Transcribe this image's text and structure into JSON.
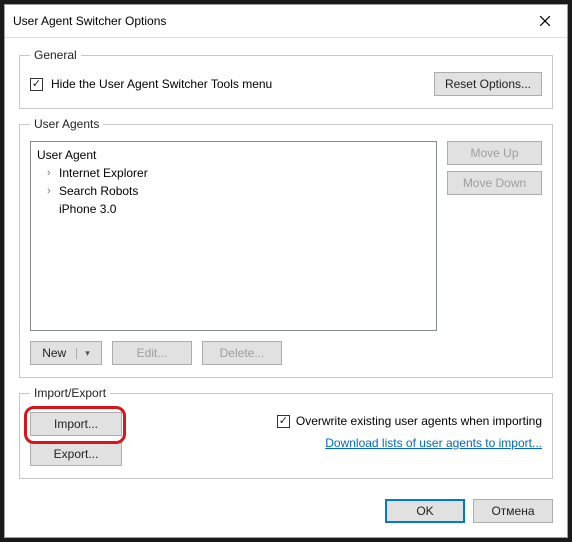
{
  "window": {
    "title": "User Agent Switcher Options"
  },
  "general": {
    "legend": "General",
    "hide_menu_label": "Hide the User Agent Switcher Tools menu",
    "hide_menu_checked": true,
    "reset_label": "Reset Options..."
  },
  "user_agents": {
    "legend": "User Agents",
    "items": [
      {
        "label": "User Agent",
        "expandable": false,
        "indent": 0
      },
      {
        "label": "Internet Explorer",
        "expandable": true,
        "indent": 1
      },
      {
        "label": "Search Robots",
        "expandable": true,
        "indent": 1
      },
      {
        "label": "iPhone 3.0",
        "expandable": false,
        "indent": 2
      }
    ],
    "move_up": "Move Up",
    "move_down": "Move Down",
    "new_label": "New",
    "edit_label": "Edit...",
    "delete_label": "Delete..."
  },
  "import_export": {
    "legend": "Import/Export",
    "import_label": "Import...",
    "export_label": "Export...",
    "overwrite_label": "Overwrite existing user agents when importing",
    "overwrite_checked": true,
    "download_link": "Download lists of user agents to import..."
  },
  "footer": {
    "ok": "OK",
    "cancel": "Отмена"
  }
}
